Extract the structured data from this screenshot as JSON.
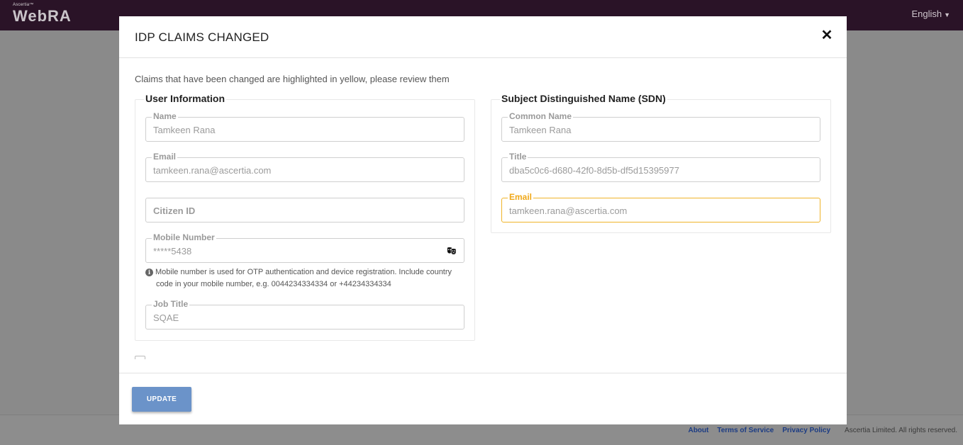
{
  "app": {
    "logo_small": "Ascertia™",
    "logo_main": "WebRA",
    "language": "English"
  },
  "footer": {
    "about": "About",
    "terms": "Terms of Service",
    "privacy": "Privacy Policy",
    "copyright": "Ascertia Limited. All rights reserved."
  },
  "modal": {
    "title": "IDP CLAIMS CHANGED",
    "intro": "Claims that have been changed are highlighted in yellow, please review them",
    "user_info": {
      "legend": "User Information",
      "name": {
        "label": "Name",
        "value": "Tamkeen Rana"
      },
      "email": {
        "label": "Email",
        "value": "tamkeen.rana@ascertia.com"
      },
      "citizen_id": {
        "placeholder": "Citizen ID"
      },
      "mobile": {
        "label": "Mobile Number",
        "value": "*****5438"
      },
      "hint_line1": "Mobile number is used for OTP authentication and device registration. Include country",
      "hint_line2": "code in your mobile number, e.g. 0044234334334 or +44234334334",
      "job_title": {
        "label": "Job Title",
        "value": "SQAE"
      }
    },
    "sdn": {
      "legend": "Subject Distinguished Name (SDN)",
      "common_name": {
        "label": "Common Name",
        "value": "Tamkeen Rana"
      },
      "title": {
        "label": "Title",
        "value": "dba5c0c6-d680-42f0-8d5b-df5d15395977"
      },
      "email": {
        "label": "Email",
        "value": "tamkeen.rana@ascertia.com"
      }
    },
    "update_label": "UPDATE"
  },
  "colors": {
    "changed_highlight": "#f0b429",
    "primary_button": "#6b93c9",
    "topbar": "#2a1327"
  }
}
